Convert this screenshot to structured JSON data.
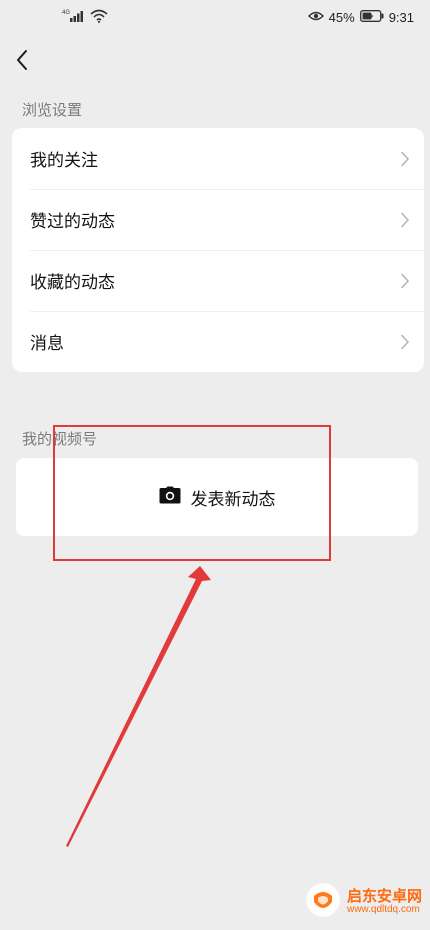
{
  "status_bar": {
    "battery_percent": "45%",
    "time": "9:31"
  },
  "sections": {
    "browse_settings": {
      "label": "浏览设置",
      "items": [
        {
          "label": "我的关注"
        },
        {
          "label": "赞过的动态"
        },
        {
          "label": "收藏的动态"
        },
        {
          "label": "消息"
        }
      ]
    },
    "my_channel": {
      "label": "我的视频号",
      "post_button_label": "发表新动态"
    }
  },
  "watermark": {
    "title": "启东安卓网",
    "url": "www.qdltdq.com"
  },
  "colors": {
    "page_background": "#ededed",
    "card_background": "#ffffff",
    "annotation": "#e23a3a",
    "watermark": "#ff6a10"
  },
  "icons": [
    "signal-icon",
    "wifi-icon",
    "eye-icon",
    "battery-icon",
    "back-arrow-icon",
    "chevron-right-icon",
    "camera-icon"
  ]
}
